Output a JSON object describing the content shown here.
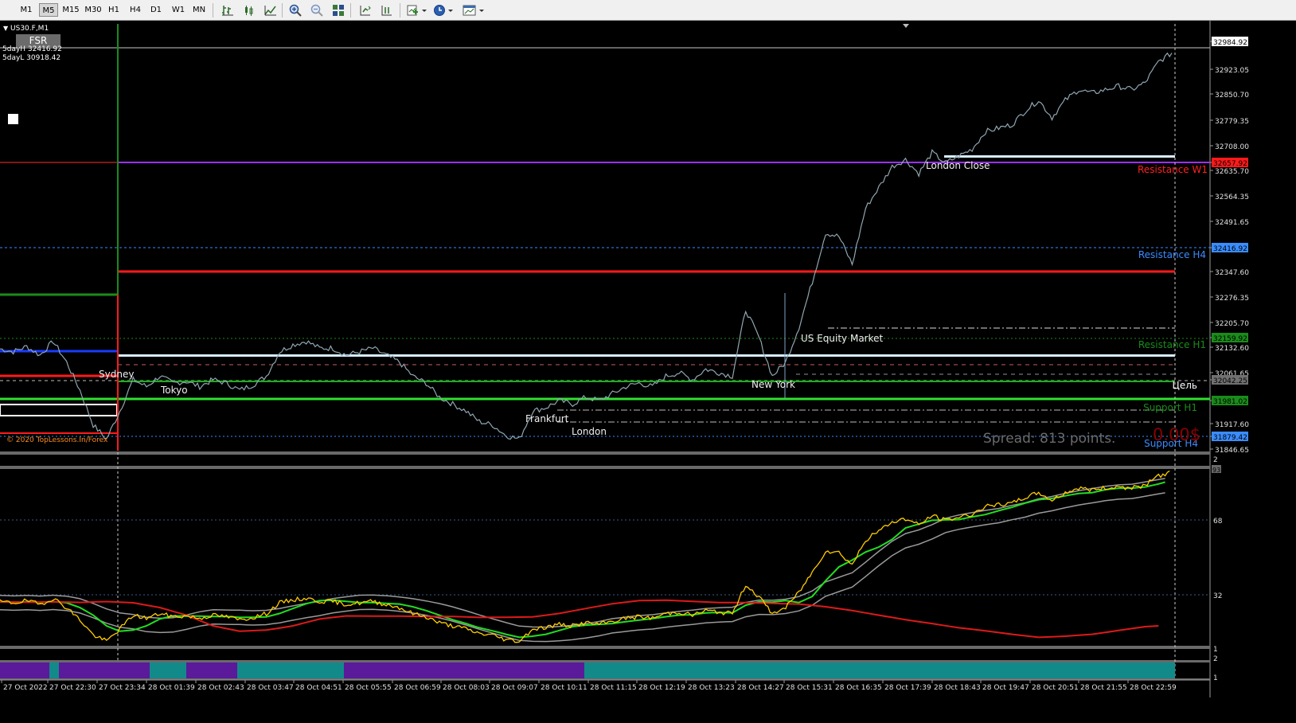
{
  "toolbar": {
    "timeframes": [
      "M1",
      "M5",
      "M15",
      "M30",
      "H1",
      "H4",
      "D1",
      "W1",
      "MN"
    ],
    "active_timeframe": "M5",
    "icons": [
      "bar-chart-icon",
      "candlestick-icon",
      "line-chart-icon",
      "zoom-in-icon",
      "zoom-out-icon",
      "tile-windows-icon",
      "chart-shift-icon",
      "autoscroll-icon",
      "indicators-icon",
      "periodicity-icon",
      "templates-icon"
    ]
  },
  "chart": {
    "symbol": "US30.F,M1",
    "button_fsr": "FSR",
    "day_high": "5dayH 32416.92",
    "day_low": "5dayL 30918.42",
    "copyright": "© 2020 TopLessons.In/Forex",
    "spread_text": "Spread: 813 points.",
    "profit_text": "0.00$",
    "sessions": [
      "Sydney",
      "Tokyo",
      "Frankfurt",
      "London",
      "New York",
      "US Equity Market",
      "London Close"
    ],
    "levels": [
      {
        "label": "Resistance W1",
        "color": "#ff2020"
      },
      {
        "label": "Resistance H4",
        "color": "#3a8cff"
      },
      {
        "label": "Resistance H1",
        "color": "#1a8c1a"
      },
      {
        "label": "Цель",
        "color": "#ffffff"
      },
      {
        "label": "Support H1",
        "color": "#1a8c1a"
      },
      {
        "label": "Support H4",
        "color": "#3a8cff"
      }
    ],
    "price_axis": [
      "32984.92",
      "32923.05",
      "32850.70",
      "32779.35",
      "32708.00",
      "32657.92",
      "32635.70",
      "32564.35",
      "32491.65",
      "32416.92",
      "32347.60",
      "32276.35",
      "32205.70",
      "32159.92",
      "32132.60",
      "32061.65",
      "32042.25",
      "31981.02",
      "31917.60",
      "31879.42",
      "31846.65"
    ],
    "price_highlight": {
      "current": "32984.92",
      "resistance_w1": "32657.92",
      "resistance_h4": "32416.92",
      "resistance_h1": "32159.92",
      "target": "32042.25",
      "support_h1": "31981.02",
      "support_h4": "31879.42"
    },
    "osc_axis": [
      "2",
      "93",
      "68",
      "32",
      "1",
      "2",
      "1"
    ],
    "time_axis": [
      "27 Oct 2022",
      "27 Oct 22:30",
      "27 Oct 23:34",
      "28 Oct 01:39",
      "28 Oct 02:43",
      "28 Oct 03:47",
      "28 Oct 04:51",
      "28 Oct 05:55",
      "28 Oct 06:59",
      "28 Oct 08:03",
      "28 Oct 09:07",
      "28 Oct 10:11",
      "28 Oct 11:15",
      "28 Oct 12:19",
      "28 Oct 13:23",
      "28 Oct 14:27",
      "28 Oct 15:31",
      "28 Oct 16:35",
      "28 Oct 17:39",
      "28 Oct 18:43",
      "28 Oct 19:47",
      "28 Oct 20:51",
      "28 Oct 21:55",
      "28 Oct 22:59"
    ]
  },
  "chart_data": {
    "type": "line",
    "title": "US30.F,M1",
    "xlabel": "",
    "ylabel": "",
    "ylim": [
      31846.65,
      33020
    ],
    "series": [
      {
        "color": "#7fa3c8",
        "values": [
          32138,
          32130,
          32145,
          32120,
          32160,
          32100,
          32020,
          31920,
          31880,
          31960,
          32050,
          32030,
          32060,
          32040,
          32045,
          32030,
          32050,
          32040,
          32020,
          32035,
          32060,
          32130,
          32150,
          32160,
          32140,
          32140,
          32120,
          32130,
          32140,
          32120,
          32100,
          32060,
          32040,
          32000,
          31980,
          31960,
          31930,
          31920,
          31890,
          31880,
          31960,
          31970,
          31990,
          31980,
          32000,
          31990,
          32010,
          32030,
          32040,
          32030,
          32060,
          32070,
          32050,
          32080,
          32070,
          32060,
          32250,
          32170,
          32060,
          32100,
          32200,
          32330,
          32470,
          32460,
          32380,
          32540,
          32600,
          32660,
          32680,
          32640,
          32700,
          32670,
          32690,
          32710,
          32760,
          32770,
          32780,
          32820,
          32850,
          32800,
          32850,
          32880,
          32870,
          32880,
          32890,
          32880,
          32900,
          32960,
          32985
        ]
      }
    ]
  }
}
